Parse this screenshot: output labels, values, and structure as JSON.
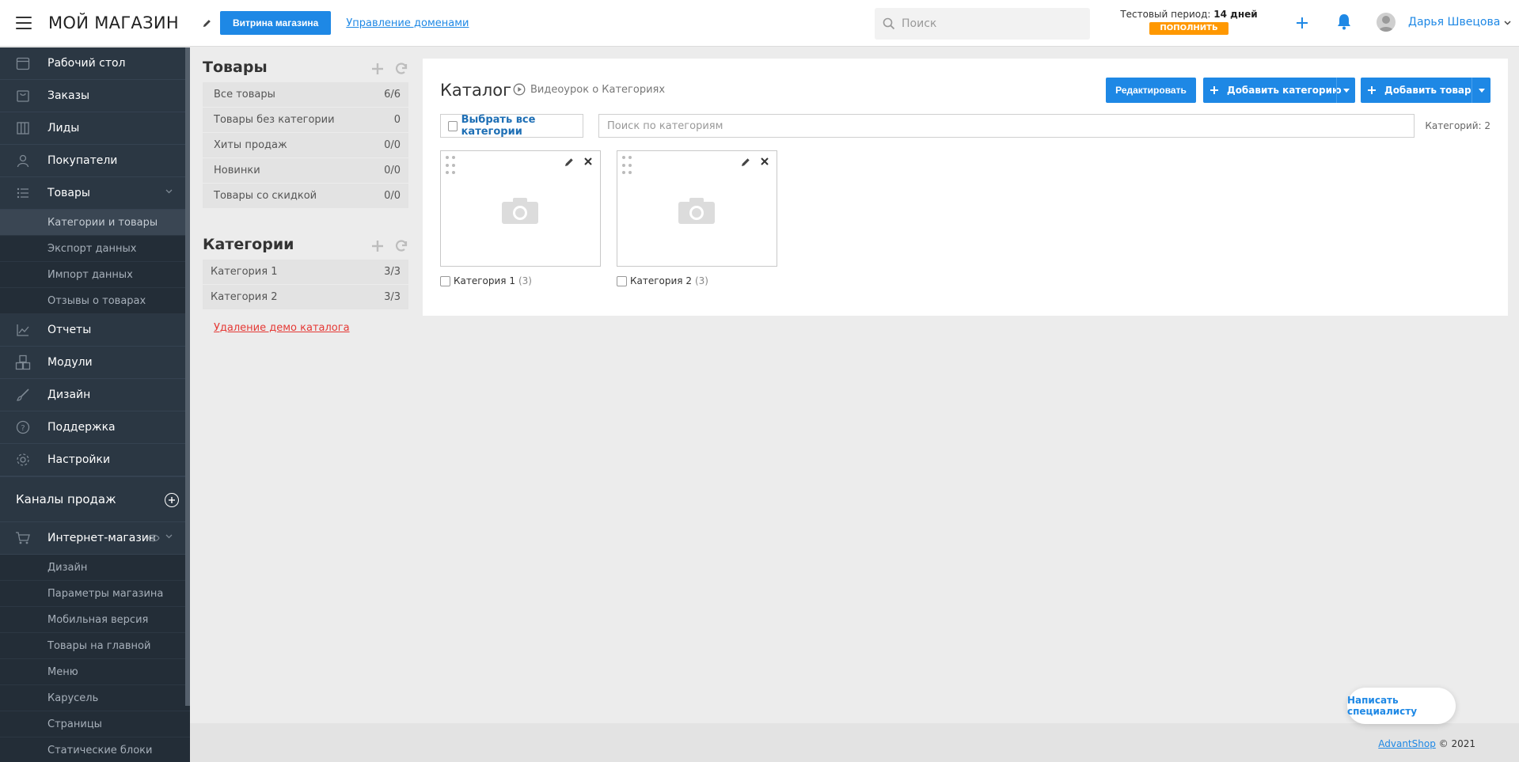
{
  "header": {
    "shop_title": "МОЙ МАГАЗИН",
    "storefront_button": "Витрина магазина",
    "domains_link": "Управление доменами",
    "search_placeholder": "Поиск",
    "trial_prefix": "Тестовый период: ",
    "trial_days": "14 дней",
    "topup_button": "ПОПОЛНИТЬ",
    "user_name": "Дарья Швецова"
  },
  "sidebar": {
    "items": [
      {
        "label": "Рабочий стол",
        "icon": "calendar-icon"
      },
      {
        "label": "Заказы",
        "icon": "bag-icon"
      },
      {
        "label": "Лиды",
        "icon": "kanban-icon"
      },
      {
        "label": "Покупатели",
        "icon": "user-icon"
      },
      {
        "label": "Товары",
        "icon": "list-icon"
      }
    ],
    "products_sub": [
      "Категории и товары",
      "Экспорт данных",
      "Импорт данных",
      "Отзывы о товарах"
    ],
    "items2": [
      {
        "label": "Отчеты",
        "icon": "chart-icon"
      },
      {
        "label": "Модули",
        "icon": "cubes-icon"
      },
      {
        "label": "Дизайн",
        "icon": "brush-icon"
      },
      {
        "label": "Поддержка",
        "icon": "help-icon"
      },
      {
        "label": "Настройки",
        "icon": "gear-icon"
      }
    ],
    "channels_title": "Каналы продаж",
    "shop_channel": "Интернет-магазин",
    "shop_sub": [
      "Дизайн",
      "Параметры магазина",
      "Мобильная версия",
      "Товары на главной",
      "Меню",
      "Карусель",
      "Страницы",
      "Статические блоки"
    ]
  },
  "left_panel": {
    "products_title": "Товары",
    "products": [
      {
        "label": "Все товары",
        "count": "6/6"
      },
      {
        "label": "Товары без категории",
        "count": "0"
      },
      {
        "label": "Хиты продаж",
        "count": "0/0"
      },
      {
        "label": "Новинки",
        "count": "0/0"
      },
      {
        "label": "Товары со скидкой",
        "count": "0/0"
      }
    ],
    "categories_title": "Категории",
    "categories": [
      {
        "label": "Категория 1",
        "count": "3/3"
      },
      {
        "label": "Категория 2",
        "count": "3/3"
      }
    ],
    "demo_delete_link": "Удаление демо каталога"
  },
  "catalog": {
    "title": "Каталог",
    "video_link": "Видеоурок о Категориях",
    "edit_button": "Редактировать",
    "add_category_button": "Добавить категорию",
    "add_product_button": "Добавить товар",
    "select_all": "Выбрать все категории",
    "search_placeholder": "Поиск по категориям",
    "categories_count": "Категорий: 2",
    "cards": [
      {
        "name": "Категория 1",
        "count": "(3)"
      },
      {
        "name": "Категория 2",
        "count": "(3)"
      }
    ]
  },
  "footer": {
    "brand_link": "AdvantShop",
    "copyright": "© 2021"
  },
  "chat_button": "Написать специалисту",
  "colors": {
    "accent": "#1e88e5",
    "sidebar_bg": "#2b3743",
    "topup": "#ff9800",
    "danger": "#e53935"
  }
}
